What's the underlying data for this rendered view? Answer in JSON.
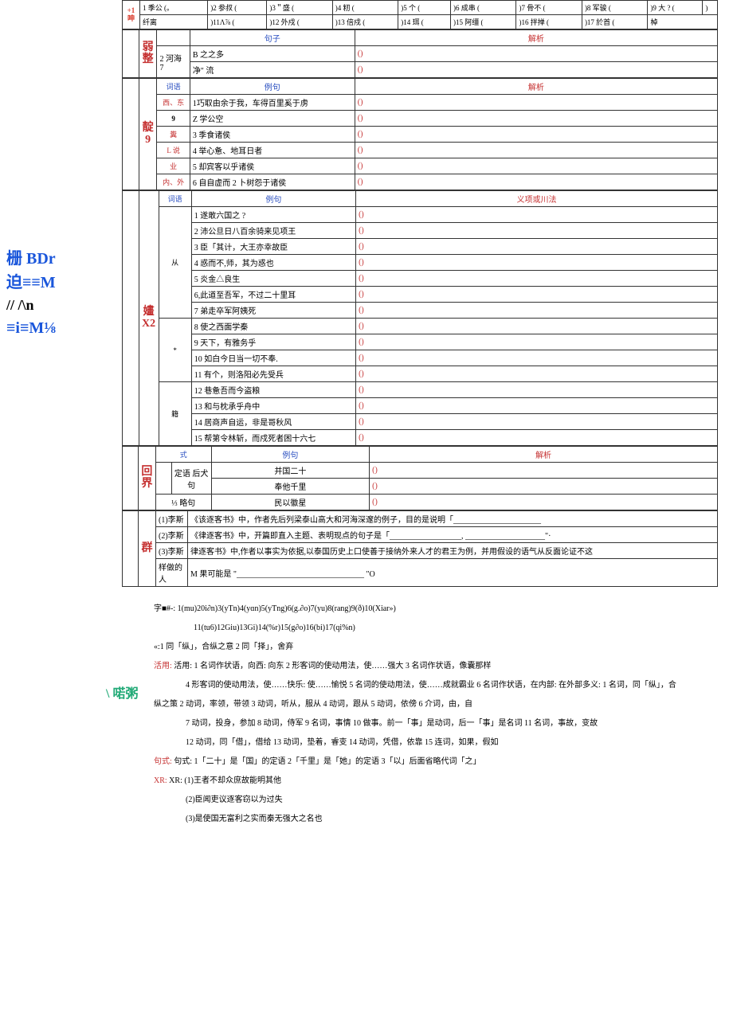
{
  "leftcol": {
    "l1": "栅 BDr",
    "l2": "迫≡≡M",
    "l3": "// /\\n",
    "l4": "≡i≡M⅛"
  },
  "phon": {
    "row1": [
      "1 季公 (。",
      "纤离",
      ")2 参叔 (",
      ")3＂盛 (",
      ")4 籾 (",
      ")5 个 (",
      ")6 成串 (",
      ")7 骨不 (",
      ")8 军骏 (",
      ")9 大 ? (",
      " )"
    ],
    "row2": [
      ")11Λ⅞ (",
      ")12 外戍 (",
      ")13 倍戍 (",
      ")14 珥 (",
      ")15 阿缰 (",
      ")16 拌掸 (",
      ")17 於首 (",
      "棹"
    ]
  },
  "sec2": {
    "head": "弱整",
    "h1": "句子",
    "h2": "解析",
    "r1a": "B 之之多",
    "r1b": "()",
    "r2a": "2 河海 7",
    "r2b": "净\" 流",
    "r2c": "()"
  },
  "sec3": {
    "head": "靛9",
    "h1": "词语",
    "h2": "例句",
    "h3": "解析",
    "rows": [
      {
        "a": "西、东",
        "b": "1巧取由余于我，车得百里奚于虏",
        "c": "()"
      },
      {
        "a": "9",
        "b": "Z 学公空",
        "c": "()"
      },
      {
        "a": "糞",
        "b": "3 季食诸侯",
        "c": "()"
      },
      {
        "a": "L 说",
        "b": "4 举心惫、地耳日者",
        "c": "()"
      },
      {
        "a": "业",
        "b": "5 却宾客以乎诸侯",
        "c": "()"
      },
      {
        "a": "内、外",
        "b": "6 自自虚而 2 卜树怨于诸侯",
        "c": "()"
      }
    ]
  },
  "sec4": {
    "head": "嫿X2",
    "h1": "词语",
    "h2": "例句",
    "h3": "义项或川法",
    "groups": [
      {
        "label": "从",
        "rows": [
          {
            "b": "1 遂敢六国之 ?",
            "c": "()"
          },
          {
            "b": "2 沛公旦日八百余骑来见项王",
            "c": "()"
          },
          {
            "b": "3 臣「其计，大王亦幸故臣",
            "c": "()"
          },
          {
            "b": "4 惑而不,师，其为惑也",
            "c": "()"
          },
          {
            "b": "5 炎金△良生",
            "c": "()"
          },
          {
            "b": "6,此道至吾军，不过二十里耳",
            "c": "()"
          },
          {
            "b": "7 弟走卒军阿姨死",
            "c": "()"
          }
        ]
      },
      {
        "label": "*",
        "rows": [
          {
            "b": "8 使之西面学秦",
            "c": "()"
          },
          {
            "b": "9 天下，有雅务乎",
            "c": "()"
          },
          {
            "b": "10 如白今日当一切不奉.",
            "c": "()"
          },
          {
            "b": "11 有个，则洛阳必先受兵",
            "c": "()"
          }
        ]
      },
      {
        "label": "籍",
        "rows": [
          {
            "b": "12 巷惫吾而今盗粮",
            "c": "()"
          },
          {
            "b": "13 和与枕承乎舟中",
            "c": "()"
          },
          {
            "b": "14 居商声自运，非是哥秋风",
            "c": "()"
          },
          {
            "b": "15 帮第令林斩，而戍死者困十六七",
            "c": "()"
          }
        ]
      }
    ]
  },
  "sec5": {
    "head": "回界",
    "h1": "式",
    "h2": "例句",
    "h3": "解析",
    "g1": "定语 后犬句",
    "r1a": "并国二十",
    "r1b": "()",
    "r2a": "奉他千里",
    "r2b": "()",
    "g2": "⅓ 略句",
    "r3a": "民以徽星",
    "r3b": "()"
  },
  "sec6": {
    "head": "群",
    "r1": "(1)李斯",
    "r1t": "《该逐客书》中，作者先后列梁泰山高大和河海深邃的例子，目的是说明「______________________",
    "r2": "(2)李斯",
    "r2t": "《律逐客书》中，开篇即直入主题、表明现点的句子是「__________________, ____________________\"·",
    "r3": "(3)李斯",
    "r3t": "  律逐客书》中,作者以事实为依据,以泰国历史上口使善于接纳外来人才的君王为例，并用假设的语气从反面论证不这",
    "r4": "样做的人",
    "r4t": "M 果可能是 \"________________________________   \"O"
  },
  "answers": {
    "l1": "字■#-: 1(mu)20i∂n)3(yTn)4(yɑn)5(yTng)6(g.∂o)7(yu)8(rang)9(ð)10(Xiar»)",
    "l2": "11(tu6)12Giu)13Gi)14(%r)15(g∂o)16(bi)17(qi%n)",
    "l3": "«:1 同「纵」，合纵之意 2 同「择」，舍弃",
    "l4": "活用: 1 名词作状语，向西: 向东 2 形客词的使动用法，使……强大 3 名词作状语，像囊那样",
    "l5": "4 形客词的使动用法，使……快乐: 使……愉悦 5 名词的使动用法，使……成就霸业 6 名词作状语，在内部: 在外部多义: 1 名词，同「纵」，合",
    "l6": "纵之策 2 动词，率领，带领 3 动词，听从，服从 4 动词，跟从 5 动词，依傍 6 介词，由，自",
    "l7": "7 动词，投身，参加 8 动词，侍军 9 名词，事情 10 做事。前一「事」是动词，后一「事」是名词 11 名词，事故，变故",
    "l8": "12 动词，同「借」，借给 13 动词，垫着，睿变 14 动词，凭借，依靠 15 连词，如果，假如",
    "l9": "句式: 1「二十」是「国」的定语 2「千里」是「她」的定语 3「以」后面省略代词「之」",
    "l10": "XR: (1)王者不却众庶故能明其他",
    "l11": "(2)臣闻吏议逐客窃以为过失",
    "l12": "(3)是使国无富利之实而秦无强大之名也"
  },
  "bottom_icon": "喏粥"
}
